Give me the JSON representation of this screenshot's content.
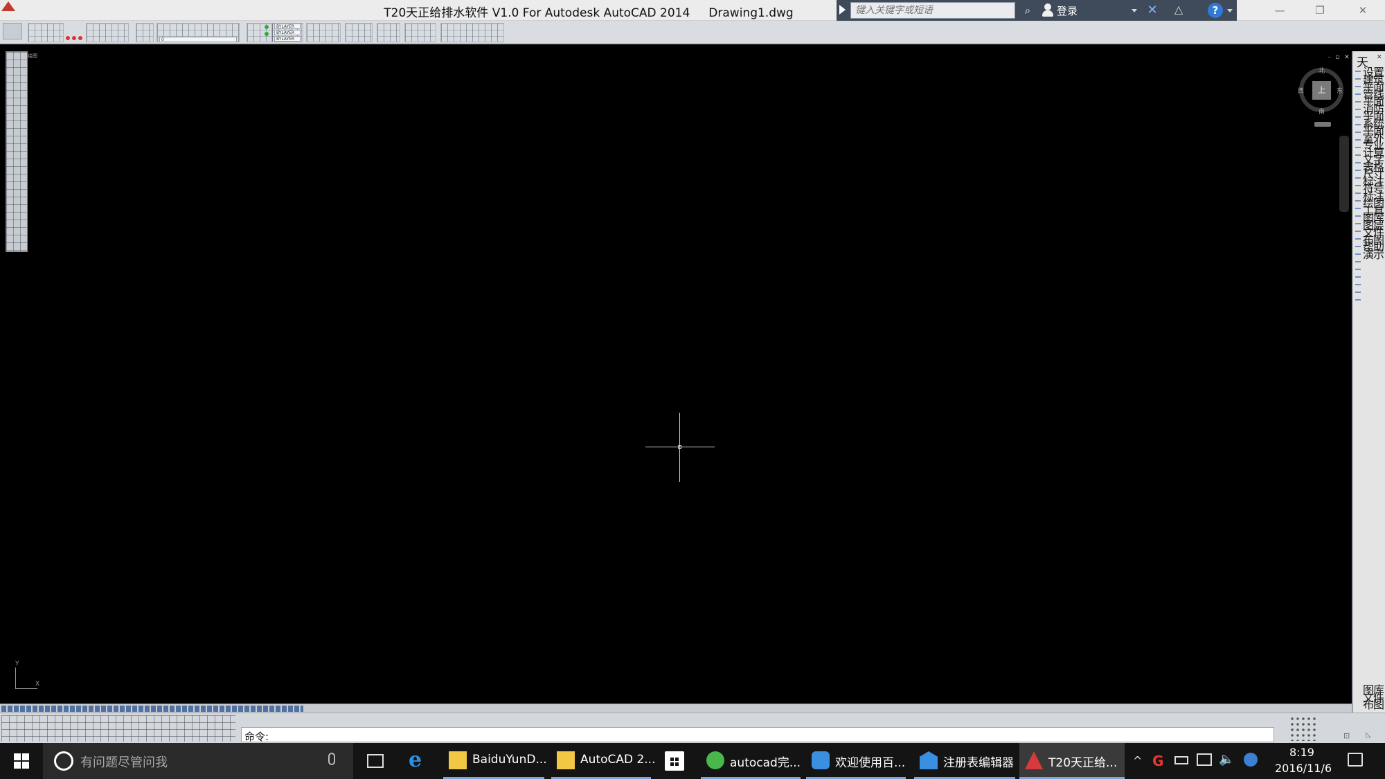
{
  "window": {
    "title": "T20天正给排水软件 V1.0 For Autodesk AutoCAD 2014     Drawing1.dwg",
    "search_placeholder": "键入关键字或短语",
    "login_label": "登录",
    "minimize": "—",
    "restore": "❐",
    "close": "✕"
  },
  "toolbar": {
    "layer_value": "0",
    "bylayer_1": "BYLAYER",
    "bylayer_2": "BYLAYER",
    "bylayer_3": "BYLAYER"
  },
  "canvas": {
    "palette_label": "绘图",
    "viewport_controls": "- ▫ ✕",
    "ucs_x": "X",
    "ucs_y": "Y",
    "background_color": "#000000"
  },
  "viewcube": {
    "face": "上",
    "north": "北",
    "south": "南",
    "east": "东",
    "west": "西"
  },
  "right_menu": {
    "title": "天",
    "close": "✕",
    "items_text": "设置建筑平面管线平面消防平面系统平面室外专业计算文字表格尺寸标注符号标注绘图工具图库图层文件布图帮助演示",
    "bottom_text": "图库文件布图"
  },
  "command": {
    "prompt": "命令:"
  },
  "taskbar": {
    "search_text": "有问题尽管问我",
    "apps": [
      {
        "label": "BaiduYunD...",
        "icon": "folder-icon",
        "color": "#f2c744"
      },
      {
        "label": "AutoCAD 2...",
        "icon": "folder-icon",
        "color": "#f2c744"
      },
      {
        "label": "autocad完...",
        "icon": "browser-icon",
        "color": "#49b84a"
      },
      {
        "label": "欢迎使用百...",
        "icon": "baidu-cloud-icon",
        "color": "#3b8fe0"
      },
      {
        "label": "注册表编辑器",
        "icon": "registry-icon",
        "color": "#3b8fe0"
      },
      {
        "label": "T20天正给...",
        "icon": "autocad-icon",
        "color": "#d63a3a"
      }
    ],
    "time": "8:19",
    "date": "2016/11/6"
  }
}
